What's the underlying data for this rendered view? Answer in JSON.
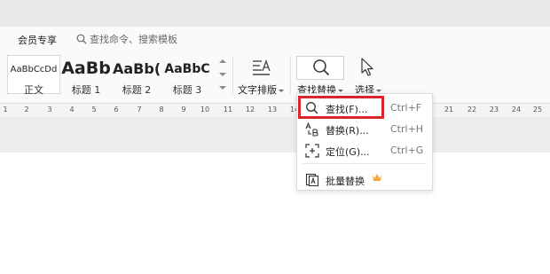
{
  "tabbar": {
    "vip_tab": "会员专享",
    "search_placeholder": "查找命令、搜索模板"
  },
  "styles": [
    {
      "sample": "AaBbCcDd",
      "label": "正文"
    },
    {
      "sample": "AaBb",
      "label": "标题 1"
    },
    {
      "sample": "AaBb(",
      "label": "标题 2"
    },
    {
      "sample": "AaBbC",
      "label": "标题 3"
    }
  ],
  "toolbar": {
    "text_layout": "文字排版",
    "find_replace": "查找替换",
    "select": "选择"
  },
  "ruler": [
    "1",
    "2",
    "3",
    "4",
    "5",
    "6",
    "7",
    "8",
    "9",
    "10",
    "11",
    "12",
    "13",
    "14",
    "21",
    "22",
    "23",
    "24",
    "25"
  ],
  "menu": {
    "find": {
      "label": "查找(F)...",
      "shortcut": "Ctrl+F"
    },
    "replace": {
      "label": "替换(R)...",
      "shortcut": "Ctrl+H"
    },
    "goto": {
      "label": "定位(G)...",
      "shortcut": "Ctrl+G"
    },
    "batch_replace": {
      "label": "批量替换"
    }
  },
  "colors": {
    "highlight_border": "#d9262c",
    "crown": "#f2a93b"
  }
}
